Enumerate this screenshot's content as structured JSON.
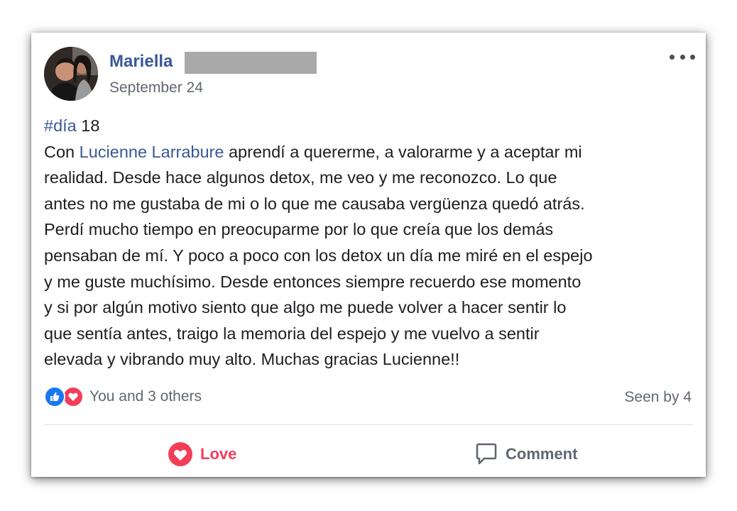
{
  "post": {
    "author_name": "Mariella",
    "date": "September 24",
    "hashtag": "#día",
    "hashtag_suffix": " 18",
    "line1_prefix": "Con ",
    "line1_mention": "Lucienne Larrabure",
    "line1_suffix": " aprendí a quererme, a valorarme y a aceptar mi",
    "lines": [
      "realidad. Desde hace algunos detox, me veo y me reconozco. Lo que",
      "antes no me gustaba de mi o lo que me causaba vergüenza quedó atrás.",
      "Perdí mucho tiempo en preocuparme por lo que creía que los demás",
      "pensaban de mí. Y poco a poco con los detox un día me miré en el espejo",
      "y me guste muchísimo. Desde entonces siempre recuerdo ese momento",
      "y si por algún motivo siento que algo me puede volver a hacer sentir lo",
      "que sentía antes, traigo la memoria del espejo y me vuelvo a sentir",
      "elevada y vibrando muy alto. Muchas gracias Lucienne!!"
    ]
  },
  "reactions": {
    "icons": [
      "like-icon",
      "love-icon"
    ],
    "summary": "You and 3 others",
    "seen": "Seen by 4"
  },
  "actions": {
    "love_label": "Love",
    "comment_label": "Comment"
  },
  "colors": {
    "link": "#385898",
    "love": "#f33e58",
    "like": "#1877f2",
    "muted": "#616770",
    "redaction": "#a9a9a9"
  }
}
